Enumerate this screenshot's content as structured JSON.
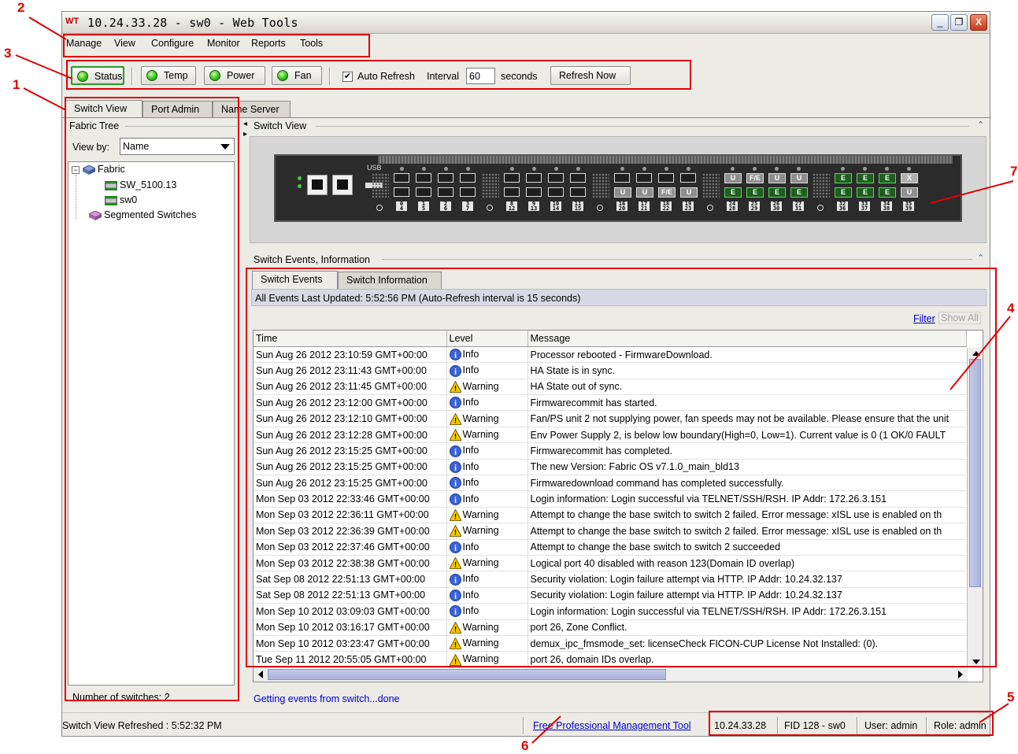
{
  "window": {
    "logo": "WT",
    "title": "10.24.33.28 - sw0 - Web Tools",
    "minimize": "_",
    "restore": "❐",
    "close": "X"
  },
  "menu": [
    "Manage",
    "View",
    "Configure",
    "Monitor",
    "Reports",
    "Tools"
  ],
  "toolbar": {
    "status": "Status",
    "temp": "Temp",
    "power": "Power",
    "fan": "Fan",
    "auto_refresh": "Auto Refresh",
    "auto_refresh_checked": true,
    "interval_label": "Interval",
    "interval_value": "60",
    "seconds": "seconds",
    "refresh_now": "Refresh Now"
  },
  "tabs": [
    "Switch View",
    "Port Admin",
    "Name Server"
  ],
  "fabric_tree": {
    "group_label": "Fabric Tree",
    "view_by_label": "View by:",
    "view_by_value": "Name",
    "nodes": [
      "Fabric",
      "SW_5100.13",
      "sw0",
      "Segmented Switches"
    ],
    "count_text": "Number of switches:  2"
  },
  "switch_view": {
    "title": "Switch View",
    "usb_label": "USB",
    "port_numbers": [
      [
        "0",
        "4"
      ],
      [
        "1",
        "5"
      ],
      [
        "2",
        "6"
      ],
      [
        "3",
        "7"
      ],
      [
        "8",
        "12"
      ],
      [
        "9",
        "13"
      ],
      [
        "10",
        "14"
      ],
      [
        "11",
        "15"
      ],
      [
        "16",
        "20"
      ],
      [
        "17",
        "21"
      ],
      [
        "18",
        "22"
      ],
      [
        "19",
        "23"
      ],
      [
        "24",
        "28"
      ],
      [
        "25",
        "29"
      ],
      [
        "26",
        "30"
      ],
      [
        "27",
        "31"
      ],
      [
        "32",
        "36"
      ],
      [
        "33",
        "37"
      ],
      [
        "34",
        "38"
      ],
      [
        "35",
        "39"
      ]
    ],
    "port_tags_g3_top": [],
    "port_tags_g3_bottom": [
      "U",
      "U",
      "F/E",
      "U"
    ],
    "port_tags_g4_top": [
      "U",
      "F/E",
      "U",
      "U"
    ],
    "port_tags_g4_bottom": [
      "E",
      "E",
      "E",
      "E"
    ],
    "port_tags_g5_top": [
      "E",
      "E",
      "E",
      "X"
    ],
    "port_tags_g5_bottom": [
      "E",
      "E",
      "E",
      "U"
    ]
  },
  "events_section": {
    "title": "Switch Events, Information",
    "tabs": [
      "Switch Events",
      "Switch Information"
    ],
    "subtitle": "All Events   Last Updated: 5:52:56 PM  (Auto-Refresh interval is 15 seconds)",
    "filter": "Filter",
    "show_all": "Show All",
    "columns": [
      "Time",
      "Level",
      "Message"
    ],
    "rows": [
      [
        "Sun Aug 26 2012 23:10:59 GMT+00:00",
        "Info",
        "Processor rebooted - FirmwareDownload."
      ],
      [
        "Sun Aug 26 2012 23:11:43 GMT+00:00",
        "Info",
        "HA State is in sync."
      ],
      [
        "Sun Aug 26 2012 23:11:45 GMT+00:00",
        "Warning",
        "HA State out of sync."
      ],
      [
        "Sun Aug 26 2012 23:12:00 GMT+00:00",
        "Info",
        "Firmwarecommit has started."
      ],
      [
        "Sun Aug 26 2012 23:12:10 GMT+00:00",
        "Warning",
        "Fan/PS unit 2 not supplying power, fan speeds may not be available. Please ensure that the unit"
      ],
      [
        "Sun Aug 26 2012 23:12:28 GMT+00:00",
        "Warning",
        "Env Power Supply 2, is below low boundary(High=0, Low=1). Current value is 0 (1 OK/0 FAULT"
      ],
      [
        "Sun Aug 26 2012 23:15:25 GMT+00:00",
        "Info",
        "Firmwarecommit has completed."
      ],
      [
        "Sun Aug 26 2012 23:15:25 GMT+00:00",
        "Info",
        "The new Version: Fabric OS v7.1.0_main_bld13"
      ],
      [
        "Sun Aug 26 2012 23:15:25 GMT+00:00",
        "Info",
        "Firmwaredownload command has completed successfully."
      ],
      [
        "Mon Sep 03 2012 22:33:46 GMT+00:00",
        "Info",
        "Login information: Login successful via TELNET/SSH/RSH. IP Addr: 172.26.3.151"
      ],
      [
        "Mon Sep 03 2012 22:36:11 GMT+00:00",
        "Warning",
        "Attempt to change the base switch to switch 2 failed.  Error message: xISL use is enabled on th"
      ],
      [
        "Mon Sep 03 2012 22:36:39 GMT+00:00",
        "Warning",
        "Attempt to change the base switch to switch 2 failed.  Error message: xISL use is enabled on th"
      ],
      [
        "Mon Sep 03 2012 22:37:46 GMT+00:00",
        "Info",
        "Attempt to change the base switch to switch 2 succeeded"
      ],
      [
        "Mon Sep 03 2012 22:38:38 GMT+00:00",
        "Warning",
        "Logical port 40 disabled with reason 123(Domain ID overlap)"
      ],
      [
        "Sat Sep 08 2012 22:51:13 GMT+00:00",
        "Info",
        "Security violation: Login failure attempt via HTTP. IP Addr: 10.24.32.137"
      ],
      [
        "Sat Sep 08 2012 22:51:13 GMT+00:00",
        "Info",
        "Security violation: Login failure attempt via HTTP. IP Addr: 10.24.32.137"
      ],
      [
        "Mon Sep 10 2012 03:09:03 GMT+00:00",
        "Info",
        "Login information: Login successful via TELNET/SSH/RSH. IP Addr: 172.26.3.151"
      ],
      [
        "Mon Sep 10 2012 03:16:17 GMT+00:00",
        "Warning",
        "port 26, Zone Conflict."
      ],
      [
        "Mon Sep 10 2012 03:23:47 GMT+00:00",
        "Warning",
        "demux_ipc_fmsmode_set: licenseCheck FICON-CUP License Not Installed: (0)."
      ],
      [
        "Tue Sep 11 2012 20:55:05 GMT+00:00",
        "Warning",
        "port 26, domain IDs overlap."
      ]
    ],
    "progress_text": "Getting events from switch...done"
  },
  "statusbar": {
    "left": "Switch View Refreshed : 5:52:32 PM",
    "link": "Free Professional Management Tool",
    "ip": "10.24.33.28",
    "fid": "FID 128 - sw0",
    "user": "User: admin",
    "role": "Role: admin"
  },
  "annotations": [
    "1",
    "2",
    "3",
    "4",
    "5",
    "6",
    "7"
  ],
  "colors": {
    "annotation": "#e00000",
    "led_green": "#2dbd16",
    "link": "#0000cc"
  }
}
